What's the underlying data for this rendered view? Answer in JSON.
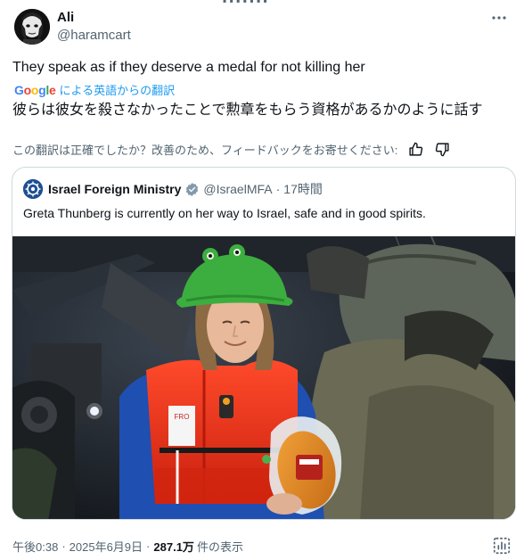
{
  "tweet": {
    "author_name": "Ali",
    "author_handle": "@haramcart",
    "text": "They speak as if they deserve a medal for not killing her",
    "translated_by_brand": "Google",
    "translated_by_label": "による英語からの翻訳",
    "translated_text": "彼らは彼女を殺さなかったことで勲章をもらう資格があるかのように話す",
    "feedback_prompt": "この翻訳は正確でしたか？改善のため、フィードバックをお寄せください:",
    "time": "午後0:38",
    "date": "2025年6月9日",
    "views_count": "287.1万",
    "views_label": "件の表示",
    "separator": "·"
  },
  "quoted": {
    "author_name": "Israel Foreign Ministry",
    "author_handle": "@IsraelMFA",
    "separator": "·",
    "time_ago": "17時間",
    "text": "Greta Thunberg is currently on her way to Israel, safe and in good spirits."
  },
  "colors": {
    "link_blue": "#1d9bf0",
    "verified_gray": "#829aab",
    "secondary_text": "#536471"
  }
}
